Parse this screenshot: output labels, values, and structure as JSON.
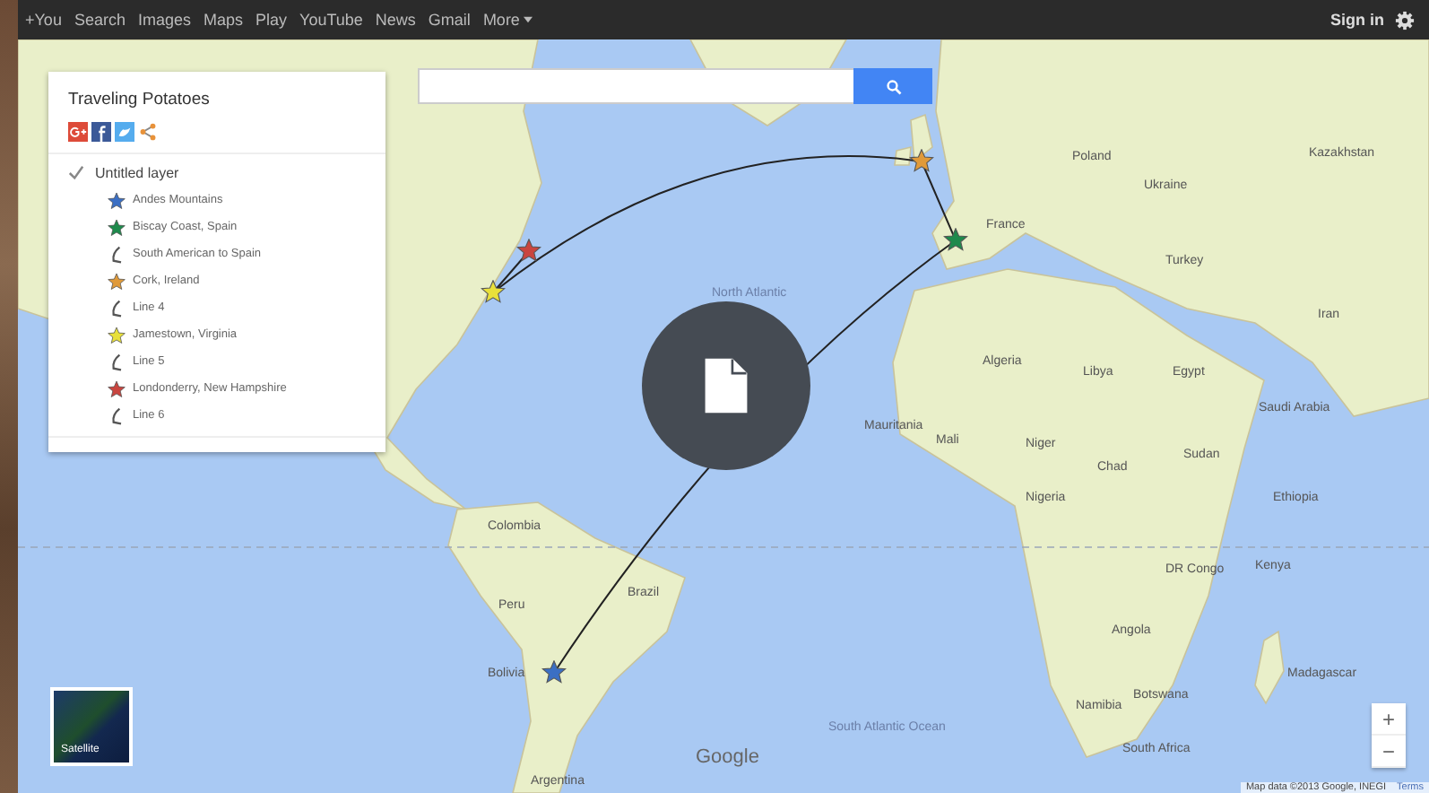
{
  "top_bar": {
    "links": [
      "+You",
      "Search",
      "Images",
      "Maps",
      "Play",
      "YouTube",
      "News",
      "Gmail",
      "More"
    ],
    "sign_in": "Sign in"
  },
  "map_panel": {
    "title": "Traveling Potatoes",
    "layer": {
      "name": "Untitled layer",
      "checked": true
    },
    "features": [
      {
        "name": "Andes Mountains",
        "kind": "star",
        "color": "#3b6fc4"
      },
      {
        "name": "Biscay Coast, Spain",
        "kind": "star",
        "color": "#1e8a4c"
      },
      {
        "name": "South American to Spain",
        "kind": "line"
      },
      {
        "name": "Cork, Ireland",
        "kind": "star",
        "color": "#e09a3a"
      },
      {
        "name": "Line 4",
        "kind": "line"
      },
      {
        "name": "Jamestown, Virginia",
        "kind": "star",
        "color": "#e8e03a"
      },
      {
        "name": "Line 5",
        "kind": "line"
      },
      {
        "name": "Londonderry, New Hampshire",
        "kind": "star",
        "color": "#c9453f"
      },
      {
        "name": "Line 6",
        "kind": "line"
      }
    ]
  },
  "map": {
    "labels": [
      "North Atlantic",
      "France",
      "Poland",
      "Ukraine",
      "Turkey",
      "Kazakhstan",
      "Iran",
      "Algeria",
      "Libya",
      "Egypt",
      "Saudi Arabia",
      "Mauritania",
      "Mali",
      "Niger",
      "Chad",
      "Sudan",
      "Nigeria",
      "Ethiopia",
      "DR Congo",
      "Kenya",
      "Angola",
      "Namibia",
      "Botswana",
      "South Africa",
      "Madagascar",
      "Colombia",
      "Peru",
      "Brazil",
      "Bolivia",
      "Argentina",
      "South Atlantic Ocean"
    ],
    "markers": [
      {
        "color": "#3b6fc4"
      },
      {
        "color": "#1e8a4c"
      },
      {
        "color": "#e09a3a"
      },
      {
        "color": "#e8e03a"
      },
      {
        "color": "#c9453f"
      }
    ],
    "logo": "Google",
    "satellite_label": "Satellite",
    "zoom_in": "+",
    "zoom_out": "−",
    "attribution": "Map data ©2013 Google, INEGI",
    "terms": "Terms"
  }
}
